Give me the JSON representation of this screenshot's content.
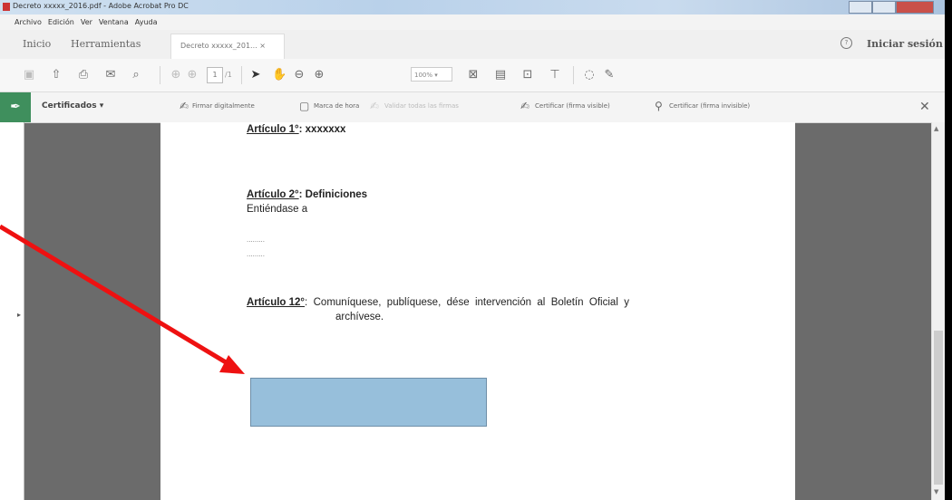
{
  "window": {
    "title": "Decreto xxxxx_2016.pdf - Adobe Acrobat Pro DC"
  },
  "menu": [
    "Archivo",
    "Edición",
    "Ver",
    "Ventana",
    "Ayuda"
  ],
  "tabs": {
    "home": "Inicio",
    "tools": "Herramientas",
    "document": "Decreto xxxxx_201... ×",
    "signin": "Iniciar sesión"
  },
  "toolbar": {
    "page_number": "1",
    "page_total": "/1",
    "zoom": "100%"
  },
  "certificates": {
    "title": "Certificados",
    "options": [
      "Firmar digitalmente",
      "Marca de hora",
      "Validar todas las firmas",
      "Certificar (firma visible)",
      "Certificar (firma invisible)"
    ]
  },
  "document": {
    "art1_label": "Artículo 1°",
    "art1_text": ": xxxxxxx",
    "art2_label": "Artículo 2°",
    "art2_text": ": Definiciones",
    "art2_body": "Entiéndase a",
    "dots1": ".........",
    "dots2": ".........",
    "art12_label": "Artículo 12°",
    "art12_text": ":  Comuníquese,  publíquese,  dése  intervención  al  Boletín  Oficial  y",
    "art12_cont": "archívese."
  },
  "colors": {
    "arrow": "#ee1111",
    "signature_box": "#97bfdb",
    "cert_accent": "#3f8f5d"
  }
}
